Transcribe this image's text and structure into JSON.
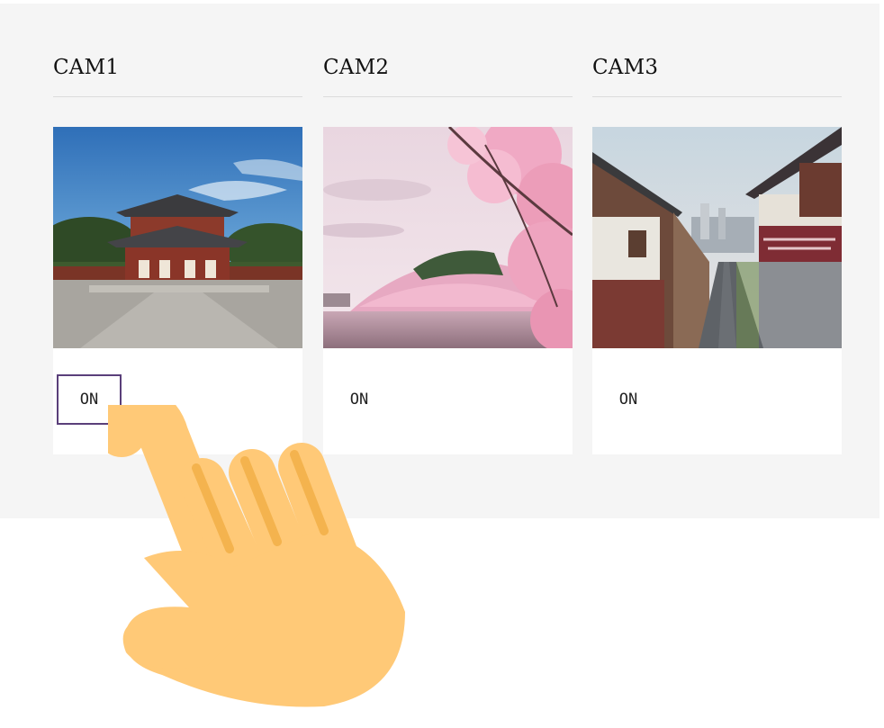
{
  "cameras": [
    {
      "title": "CAM1",
      "button_label": "ON",
      "image": "palace-photo",
      "focused": true
    },
    {
      "title": "CAM2",
      "button_label": "ON",
      "image": "cherry-blossom-photo",
      "focused": false
    },
    {
      "title": "CAM3",
      "button_label": "ON",
      "image": "hanok-street-photo",
      "focused": false
    }
  ],
  "colors": {
    "panel_bg": "#f5f5f5",
    "focus_border": "#5a3f7a",
    "hand": "#ffc977",
    "hand_shade": "#f4b34e"
  },
  "pointer_icon": "pointing-hand-icon"
}
